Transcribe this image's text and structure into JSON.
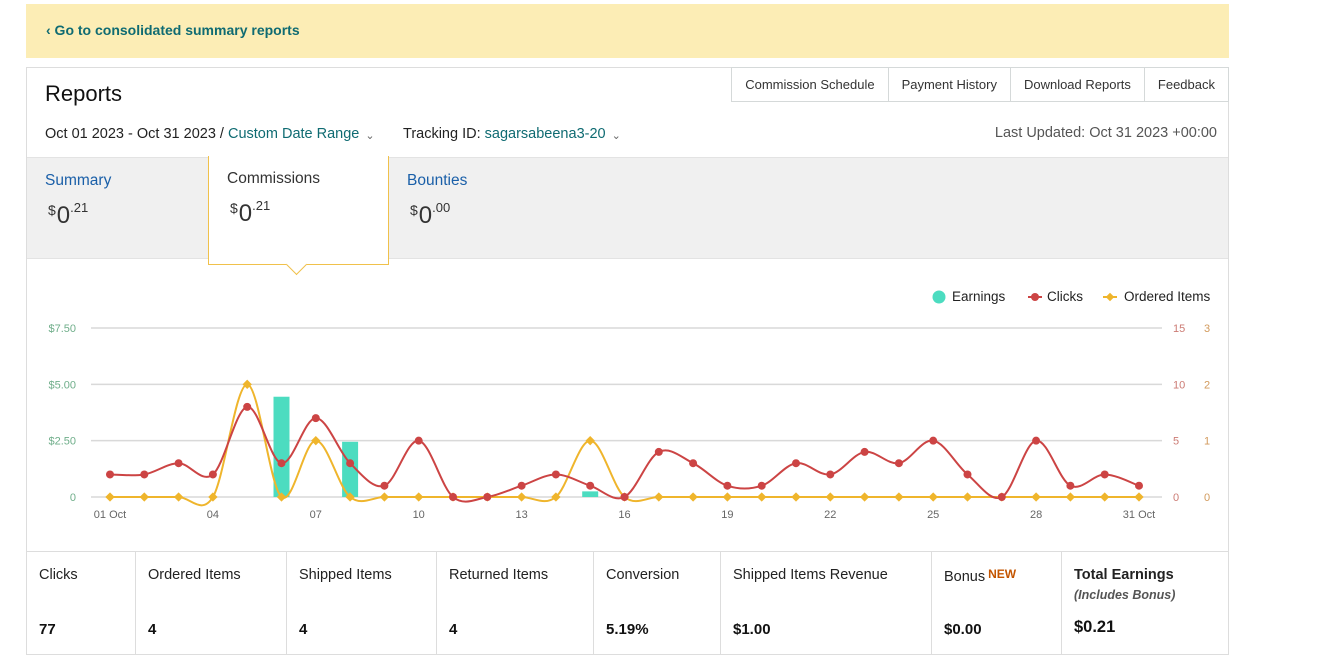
{
  "banner": {
    "link_text": "‹ Go to consolidated summary reports"
  },
  "header": {
    "title": "Reports",
    "nav": [
      "Commission Schedule",
      "Payment History",
      "Download Reports",
      "Feedback"
    ]
  },
  "filters": {
    "date_range": "Oct 01 2023 - Oct 31 2023",
    "separator": "/",
    "range_type": "Custom Date Range",
    "tracking_label": "Tracking ID:",
    "tracking_id": "sagarsabeena3-20",
    "last_updated": "Last Updated: Oct 31 2023 +00:00"
  },
  "tabs": [
    {
      "label": "Summary",
      "currency": "$",
      "whole": "0",
      "cents": ".21"
    },
    {
      "label": "Commissions",
      "currency": "$",
      "whole": "0",
      "cents": ".21"
    },
    {
      "label": "Bounties",
      "currency": "$",
      "whole": "0",
      "cents": ".00"
    }
  ],
  "colors": {
    "earnings": "#4cdcc0",
    "clicks": "#cc4444",
    "ordered_items": "#efb52c",
    "grid": "#d9d9d9",
    "axis_left": "#6fae8a",
    "axis_right1": "#cc7b74",
    "axis_right2": "#d29a5c"
  },
  "chart_data": {
    "type": "line",
    "legend": [
      "Earnings",
      "Clicks",
      "Ordered Items"
    ],
    "legend_position": "top-right",
    "x": [
      "01 Oct",
      "02",
      "03",
      "04",
      "05",
      "06",
      "07",
      "08",
      "09",
      "10",
      "11",
      "12",
      "13",
      "14",
      "15",
      "16",
      "17",
      "18",
      "19",
      "20",
      "21",
      "22",
      "23",
      "24",
      "25",
      "26",
      "27",
      "28",
      "29",
      "30",
      "31 Oct"
    ],
    "x_tick_labels": [
      "01 Oct",
      "04",
      "07",
      "10",
      "13",
      "16",
      "19",
      "22",
      "25",
      "28",
      "31 Oct"
    ],
    "y_left": {
      "ticks": [
        "$7.50",
        "$5.00",
        "$2.50",
        "0"
      ],
      "range": [
        0,
        7.5
      ]
    },
    "y_right_clicks": {
      "ticks": [
        "15",
        "10",
        "5",
        "0"
      ],
      "range": [
        0,
        15
      ]
    },
    "y_right_items": {
      "ticks": [
        "3",
        "2",
        "1",
        "0"
      ],
      "range": [
        0,
        3
      ]
    },
    "series": [
      {
        "name": "Earnings",
        "type": "bar",
        "values": [
          0,
          0,
          0,
          0,
          0,
          4.45,
          0,
          2.45,
          0,
          0,
          0,
          0,
          0,
          0,
          0.25,
          0,
          0,
          0,
          0,
          0,
          0,
          0,
          0,
          0,
          0,
          0,
          0,
          0,
          0,
          0,
          0
        ]
      },
      {
        "name": "Clicks",
        "type": "line",
        "values": [
          2,
          2,
          3,
          2,
          8,
          3,
          7,
          3,
          1,
          5,
          0,
          0,
          1,
          2,
          1,
          0,
          4,
          3,
          1,
          1,
          3,
          2,
          4,
          3,
          5,
          2,
          0,
          5,
          1,
          2,
          1
        ]
      },
      {
        "name": "Ordered Items",
        "type": "line",
        "values": [
          0,
          0,
          0,
          0,
          2,
          0,
          1,
          0,
          0,
          0,
          0,
          0,
          0,
          0,
          1,
          0,
          0,
          0,
          0,
          0,
          0,
          0,
          0,
          0,
          0,
          0,
          0,
          0,
          0,
          0,
          0
        ]
      }
    ]
  },
  "stats": [
    {
      "label": "Clicks",
      "value": "77"
    },
    {
      "label": "Ordered Items",
      "value": "4"
    },
    {
      "label": "Shipped Items",
      "value": "4"
    },
    {
      "label": "Returned Items",
      "value": "4"
    },
    {
      "label": "Conversion",
      "value": "5.19%"
    },
    {
      "label": "Shipped Items Revenue",
      "value": "$1.00"
    },
    {
      "label": "Bonus",
      "badge": "NEW",
      "value": "$0.00"
    },
    {
      "label": "Total Earnings",
      "sub": "(Includes Bonus)",
      "value": "$0.21"
    }
  ]
}
